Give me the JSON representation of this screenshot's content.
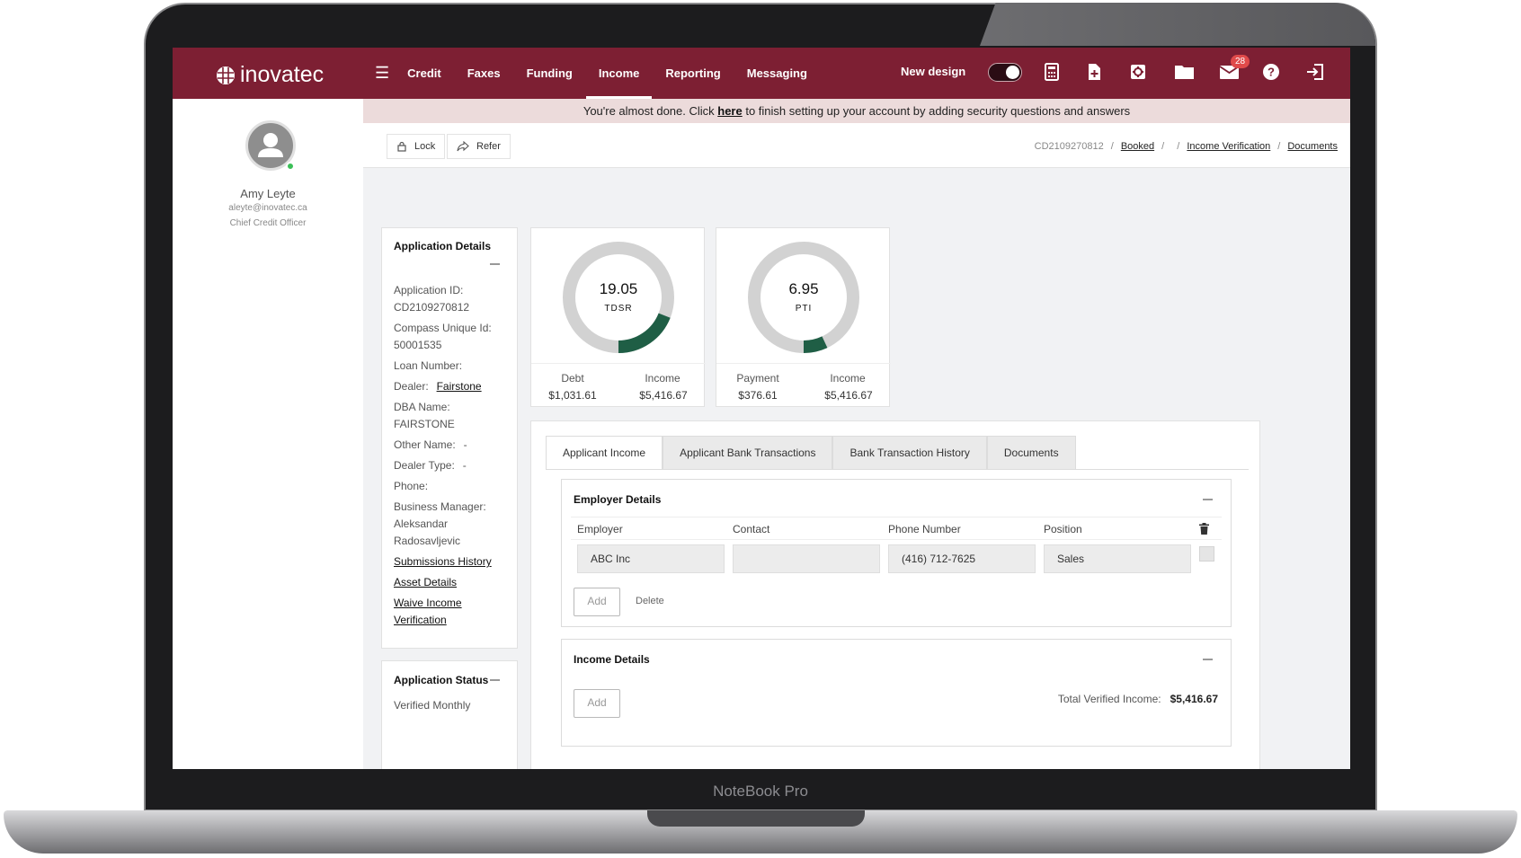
{
  "device": {
    "brand_label": "NoteBook Pro"
  },
  "topbar": {
    "logo_text": "inovatec",
    "nav": [
      "Credit",
      "Faxes",
      "Funding",
      "Income",
      "Reporting",
      "Messaging"
    ],
    "active_nav": "Income",
    "new_design_label": "New design",
    "mail_badge": "28",
    "icons": [
      "menu-icon",
      "calculator-icon",
      "new-document-icon",
      "settings-icon",
      "folder-icon",
      "mail-icon",
      "help-icon",
      "logout-icon"
    ],
    "color": "#7d1f33"
  },
  "sidebar": {
    "name": "Amy Leyte",
    "email": "aleyte@inovatec.ca",
    "title": "Chief Credit Officer"
  },
  "alert": {
    "before": "You're almost done. Click ",
    "link": "here",
    "after": " to finish setting up your account by adding security questions and answers"
  },
  "toolbar": {
    "lock_label": "Lock",
    "refer_label": "Refer",
    "crumb_id": "CD2109270812",
    "crumb_status": "Booked",
    "crumb_income": "Income Verification",
    "crumb_documents": "Documents"
  },
  "application_details": {
    "heading": "Application Details",
    "app_id_label": "Application ID:",
    "app_id": "CD2109270812",
    "compass_label": "Compass Unique Id:",
    "compass_id": "50001535",
    "loan_label": "Loan Number:",
    "dealer_label": "Dealer:",
    "dealer": "Fairstone",
    "dba_label": "DBA Name:",
    "dba": "FAIRSTONE",
    "other_label": "Other Name:",
    "other": "-",
    "dealer_type_label": "Dealer Type:",
    "dealer_type": "-",
    "phone_label": "Phone:",
    "bm_label": "Business Manager:",
    "bm_1": "Aleksandar",
    "bm_2": "Radosavljevic",
    "link_submissions": "Submissions History",
    "link_asset": "Asset Details",
    "link_waive_1": "Waive Income",
    "link_waive_2": "Verification"
  },
  "application_status": {
    "heading": "Application Status",
    "first_line": "Verified Monthly"
  },
  "gauges": [
    {
      "value": "19.05",
      "label": "TDSR",
      "fill_fraction": 0.19,
      "left_label": "Debt",
      "left_value": "$1,031.61",
      "right_label": "Income",
      "right_value": "$5,416.67"
    },
    {
      "value": "6.95",
      "label": "PTI",
      "fill_fraction": 0.07,
      "left_label": "Payment",
      "left_value": "$376.61",
      "right_label": "Income",
      "right_value": "$5,416.67"
    }
  ],
  "gauge_colors": {
    "track": "#d2d2d2",
    "fill": "#1f5e45"
  },
  "tabs": [
    "Applicant Income",
    "Applicant Bank Transactions",
    "Bank Transaction History",
    "Documents"
  ],
  "employer": {
    "heading": "Employer Details",
    "cols": [
      "Employer",
      "Contact",
      "Phone Number",
      "Position"
    ],
    "row": {
      "employer": "ABC Inc",
      "contact": "",
      "phone": "(416) 712-7625",
      "position": "Sales"
    },
    "add_label": "Add",
    "delete_label": "Delete"
  },
  "income": {
    "heading": "Income Details",
    "add_label": "Add",
    "total_label": "Total Verified Income:",
    "total_value": "$5,416.67"
  }
}
